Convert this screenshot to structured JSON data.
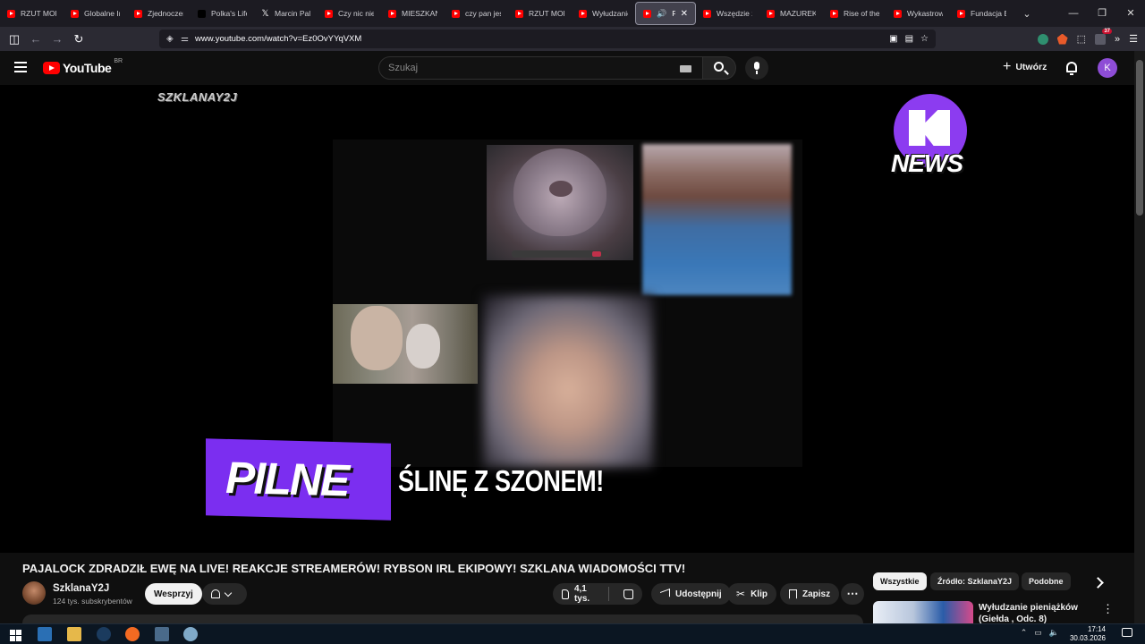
{
  "browser": {
    "tabs": [
      {
        "label": "RZUT MONETY",
        "icon": "youtube-icon"
      },
      {
        "label": "Globalne Imperium",
        "icon": "youtube-icon"
      },
      {
        "label": "Zjednoczenie",
        "icon": "youtube-icon"
      },
      {
        "label": "Polka's Life",
        "icon": "tiktok-icon"
      },
      {
        "label": "Marcin Pala",
        "icon": "x-icon"
      },
      {
        "label": "Czy nic nie",
        "icon": "youtube-icon"
      },
      {
        "label": "MIESZKANIE",
        "icon": "youtube-icon"
      },
      {
        "label": "czy pan jest",
        "icon": "youtube-icon"
      },
      {
        "label": "RZUT MONETY",
        "icon": "youtube-icon"
      },
      {
        "label": "Wyłudzanie",
        "icon": "youtube-icon"
      },
      {
        "label": "PAJA",
        "icon": "youtube-icon",
        "active": true
      },
      {
        "label": "Wszędzie za",
        "icon": "youtube-icon"
      },
      {
        "label": "MAZUREK",
        "icon": "youtube-icon"
      },
      {
        "label": "Rise of the",
        "icon": "youtube-icon"
      },
      {
        "label": "Wykastrowa",
        "icon": "youtube-icon"
      },
      {
        "label": "Fundacja EC",
        "icon": "youtube-icon"
      }
    ],
    "url": "www.youtube.com/watch?v=Ez0OvYYqVXM",
    "extension_badge": "37"
  },
  "youtube": {
    "logo_text": "YouTube",
    "country_code": "BR",
    "search_placeholder": "Szukaj",
    "create_label": "Utwórz",
    "avatar_letter": "K"
  },
  "video": {
    "watermark_left": "SZKLANAY2J",
    "news_logo_text": "NEWS",
    "banner_label": "PILNE",
    "headline_text": "ŚLINĘ Z SZONEM!",
    "title": "PAJALOCK ZDRADZIŁ EWĘ NA LIVE! REAKCJE STREAMERÓW! RYBSON IRL EKIPOWY! SZKLANA WIADOMOŚCI TTV!",
    "channel_name": "SzklanaY2J",
    "subscribers": "124 tys. subskrybentów",
    "support_label": "Wesprzyj",
    "likes": "4,1 tys.",
    "share_label": "Udostępnij",
    "clip_label": "Klip",
    "save_label": "Zapisz"
  },
  "sidebar": {
    "chips": [
      "Wszystkie",
      "Źródło: SzklanaY2J",
      "Podobne"
    ],
    "recommendation_title": "Wyłudzanie pieniążków (Giełda , Odc. 8)"
  },
  "taskbar": {
    "time": "17:14",
    "date": "30.03.2026"
  },
  "colors": {
    "youtube_red": "#ff0000",
    "brand_purple": "#7b2ef0",
    "avatar_purple": "#8e4dd6"
  }
}
